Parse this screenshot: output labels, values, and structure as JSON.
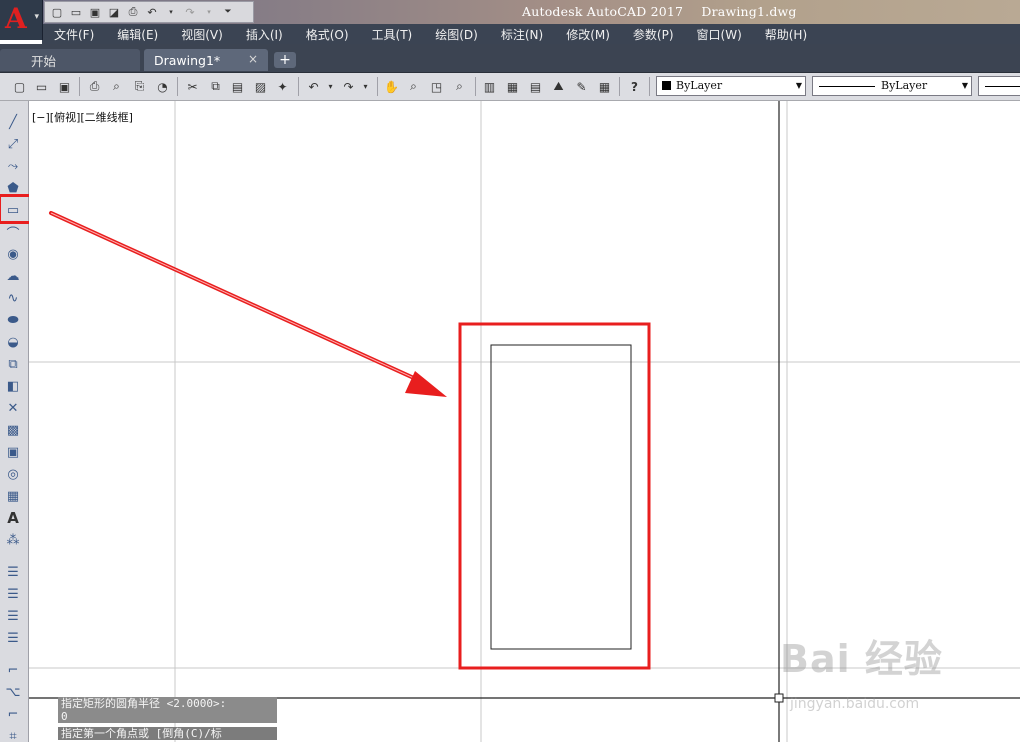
{
  "window": {
    "app_name": "Autodesk AutoCAD 2017",
    "file_name": "Drawing1.dwg"
  },
  "menu": [
    "文件(F)",
    "编辑(E)",
    "视图(V)",
    "插入(I)",
    "格式(O)",
    "工具(T)",
    "绘图(D)",
    "标注(N)",
    "修改(M)",
    "参数(P)",
    "窗口(W)",
    "帮助(H)"
  ],
  "tabs": {
    "start": "开始",
    "drawing": "Drawing1*",
    "close_glyph": "×",
    "add_glyph": "+"
  },
  "toolbar": {
    "color_combo": "ByLayer",
    "linetype_combo": "ByLayer"
  },
  "viewport": {
    "label": "[−][俯视][二维线框]"
  },
  "command": {
    "line1": "指定矩形的圆角半径 <2.0000>:",
    "line2": "0",
    "line3": "指定第一个角点或 [倒角(C)/标"
  },
  "watermark": {
    "text": "Bai 经验",
    "sub": "jingyan.baidu.com"
  },
  "colors": {
    "highlight": "#e81e1e",
    "menu_bg": "#3b4453",
    "canvas_bg": "#ffffff"
  },
  "icons": {
    "left_tools": [
      "line-icon",
      "construction-line-icon",
      "polyline-icon",
      "polygon-icon",
      "rectangle-icon",
      "arc-icon",
      "circle-icon",
      "revcloud-icon",
      "spline-icon",
      "ellipse-icon",
      "ellipse-arc-icon",
      "insert-block-icon",
      "make-block-icon",
      "point-icon",
      "hatch-icon",
      "gradient-icon",
      "region-icon",
      "table-icon",
      "text-icon",
      "add-selected-icon",
      "layer-icon-1",
      "layer-icon-2",
      "layer-icon-3",
      "layer-icon-4",
      "modify-icon-1",
      "modify-icon-2",
      "modify-icon-3",
      "modify-icon-4"
    ]
  }
}
